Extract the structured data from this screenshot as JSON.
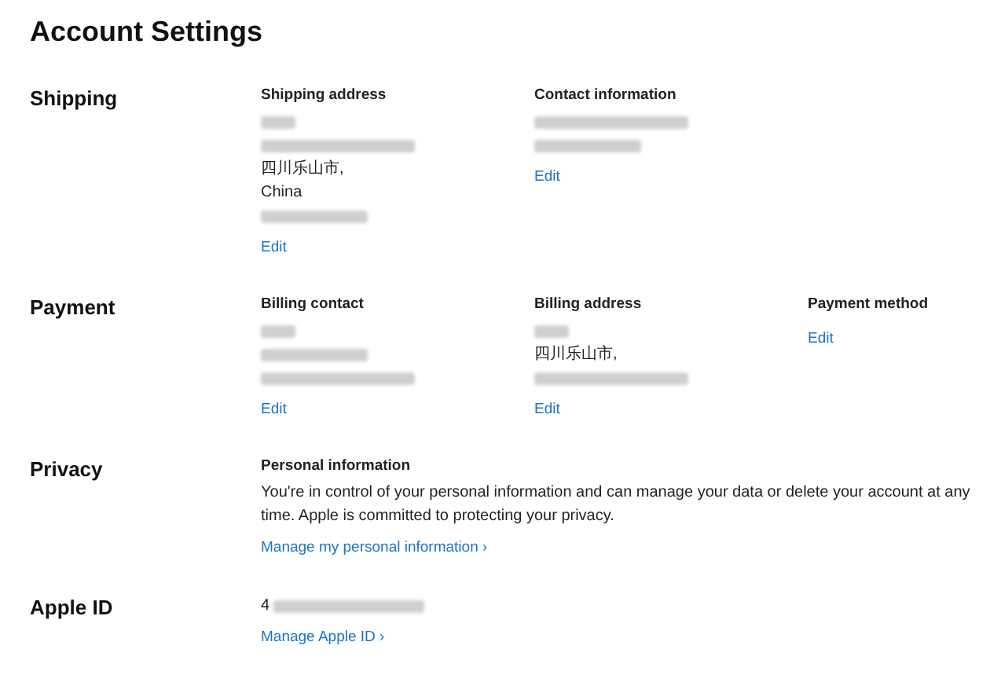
{
  "title": "Account Settings",
  "sections": [
    {
      "label": "Shipping",
      "columns": [
        {
          "heading": "Shipping address",
          "lines": [
            {
              "kind": "blur_s"
            },
            {
              "kind": "blur_l"
            },
            {
              "kind": "text",
              "text": "四川乐山市,"
            },
            {
              "kind": "text",
              "text": "China"
            },
            {
              "kind": "blur_m"
            }
          ],
          "link": "Edit"
        },
        {
          "heading": "Contact information",
          "lines": [
            {
              "kind": "blur_l"
            },
            {
              "kind": "blur_m"
            }
          ],
          "link": "Edit"
        }
      ]
    },
    {
      "label": "Payment",
      "columns": [
        {
          "heading": "Billing contact",
          "lines": [
            {
              "kind": "blur_s"
            },
            {
              "kind": "blur_m"
            },
            {
              "kind": "blur_l"
            }
          ],
          "link": "Edit"
        },
        {
          "heading": "Billing address",
          "lines": [
            {
              "kind": "blur_s"
            },
            {
              "kind": "text",
              "text": "四川乐山市,"
            },
            {
              "kind": "blur_l"
            }
          ],
          "link": "Edit"
        },
        {
          "heading": "Payment method",
          "link": "Edit"
        }
      ]
    },
    {
      "label": "Privacy",
      "columns": [
        {
          "heading": "Personal information",
          "paragraph": "You're in control of your personal information and can manage your data or delete your account at any time. Apple is committed to protecting your privacy.",
          "link": "Manage my personal information ›"
        }
      ]
    },
    {
      "label": "Apple ID",
      "columns": [
        {
          "lines": [
            {
              "kind": "text_blur",
              "text": "4"
            }
          ],
          "link": "Manage Apple ID ›"
        }
      ]
    }
  ]
}
